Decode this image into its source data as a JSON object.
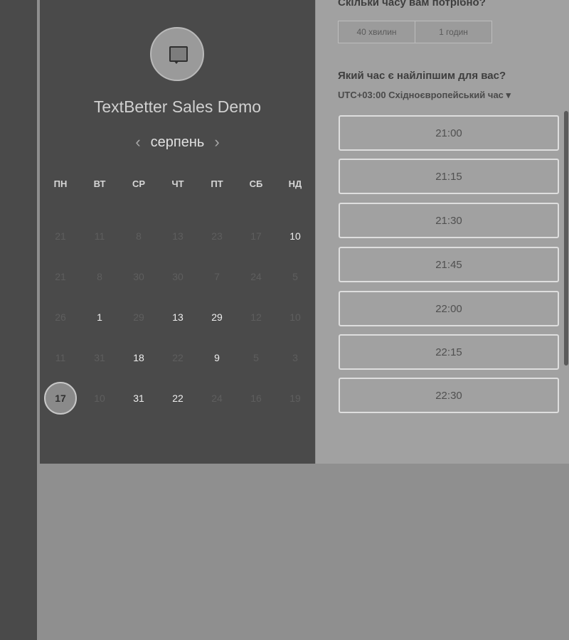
{
  "calendar": {
    "company_name": "TextBetter Sales Demo",
    "month": "серпень",
    "prev_icon": "‹",
    "next_icon": "›",
    "weekdays": [
      "ПН",
      "ВТ",
      "СР",
      "ЧТ",
      "ПТ",
      "СБ",
      "НД"
    ],
    "weeks": [
      [
        "21",
        "11",
        "8",
        "13",
        "23",
        "17",
        "10"
      ],
      [
        "21",
        "8",
        "30",
        "30",
        "7",
        "24",
        "5"
      ],
      [
        "26",
        "1",
        "29",
        "13",
        "29",
        "12",
        "10"
      ],
      [
        "11",
        "31",
        "18",
        "22",
        "9",
        "5",
        "3"
      ],
      [
        "17",
        "10",
        "31",
        "22",
        "24",
        "16",
        "19"
      ]
    ],
    "available_cells": [
      "0-6",
      "2-1",
      "2-3",
      "2-4",
      "3-2",
      "3-4",
      "4-2",
      "4-3"
    ],
    "selected_cell": "4-0"
  },
  "booking": {
    "duration_question": "Скільки часу вам потрібно?",
    "duration_options": [
      "40 хвилин",
      "1 годин"
    ],
    "time_question": "Який час є найліпшим для вас?",
    "timezone": "UTC+03:00 Східноєвропейський час",
    "timezone_icon": "▾",
    "slots": [
      "21:00",
      "21:15",
      "21:30",
      "21:45",
      "22:00",
      "22:15",
      "22:30"
    ]
  },
  "colors": {
    "left_panel": "#4a4a4a",
    "right_panel": "#a1a1a1",
    "background": "#8f8f8f"
  }
}
